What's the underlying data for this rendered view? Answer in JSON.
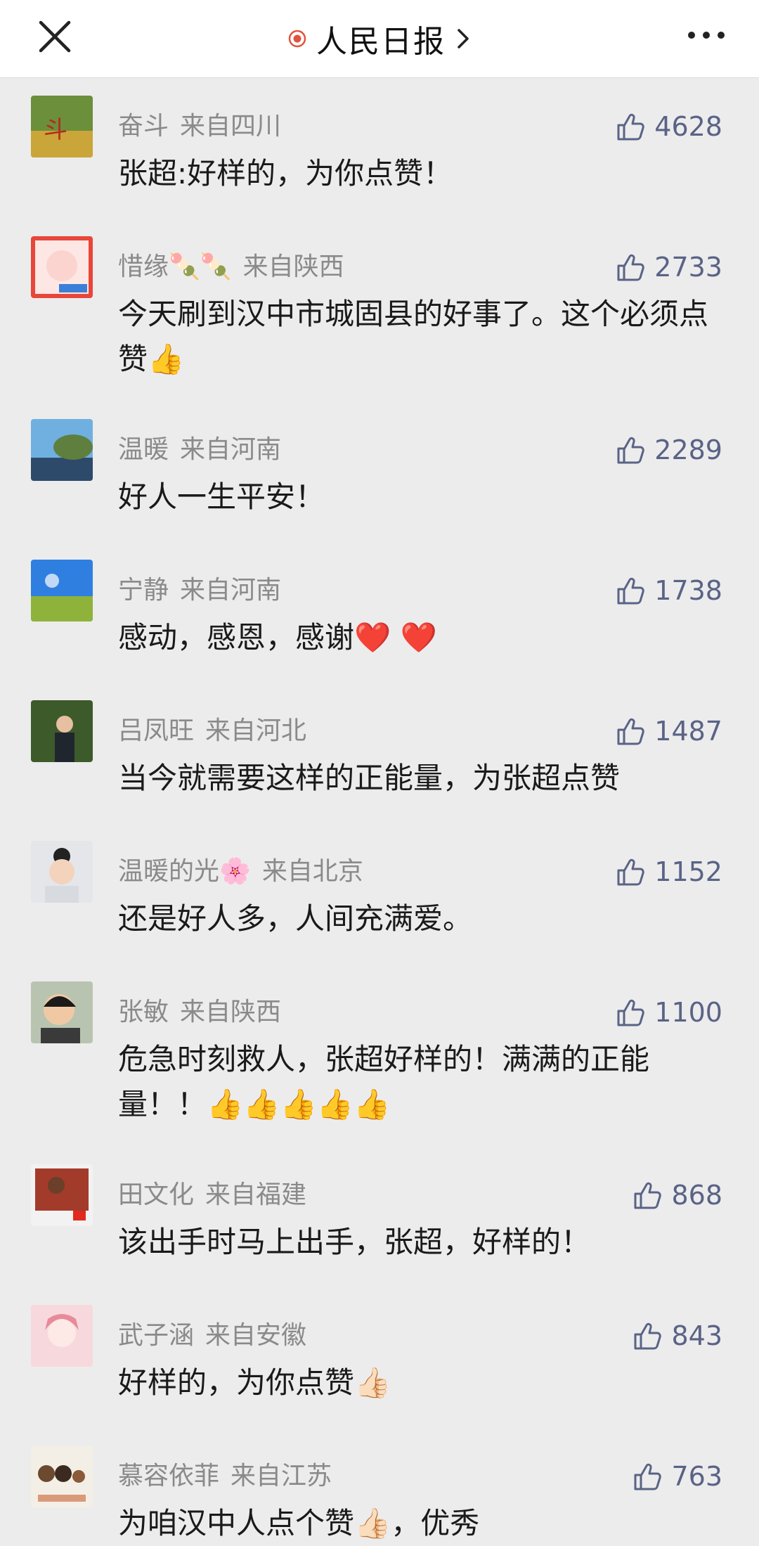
{
  "header": {
    "title": "人民日报",
    "close_icon": "close-icon",
    "more_icon": "more-icon",
    "dot_icon": "record-dot-icon",
    "dot_color": "#e0533f"
  },
  "comments": [
    {
      "name": "奋斗",
      "location": "来自四川",
      "likes": "4628",
      "text": "张超:好样的，为你点赞！"
    },
    {
      "name": "惜缘🍡🍡",
      "location": "来自陕西",
      "likes": "2733",
      "text": "今天刷到汉中市城固县的好事了。这个必须点赞👍"
    },
    {
      "name": "温暖",
      "location": "来自河南",
      "likes": "2289",
      "text": "好人一生平安！"
    },
    {
      "name": "宁静",
      "location": "来自河南",
      "likes": "1738",
      "text": "感动，感恩，感谢❤️ ❤️"
    },
    {
      "name": "吕凤旺",
      "location": "来自河北",
      "likes": "1487",
      "text": "当今就需要这样的正能量，为张超点赞"
    },
    {
      "name": "温暖的光🌸",
      "location": "来自北京",
      "likes": "1152",
      "text": "还是好人多，人间充满爱。"
    },
    {
      "name": "张敏",
      "location": "来自陕西",
      "likes": "1100",
      "text": "危急时刻救人，张超好样的！满满的正能量！！👍👍👍👍👍"
    },
    {
      "name": "田文化",
      "location": "来自福建",
      "likes": "868",
      "text": "该出手时马上出手，张超，好样的！"
    },
    {
      "name": "武子涵",
      "location": "来自安徽",
      "likes": "843",
      "text": "好样的，为你点赞👍🏻"
    },
    {
      "name": "慕容依菲",
      "location": "来自江苏",
      "likes": "763",
      "text": "为咱汉中人点个赞👍🏻，优秀"
    }
  ],
  "colors": {
    "like": "#5a6386",
    "meta": "#8a8a8a",
    "background": "#ececec"
  }
}
